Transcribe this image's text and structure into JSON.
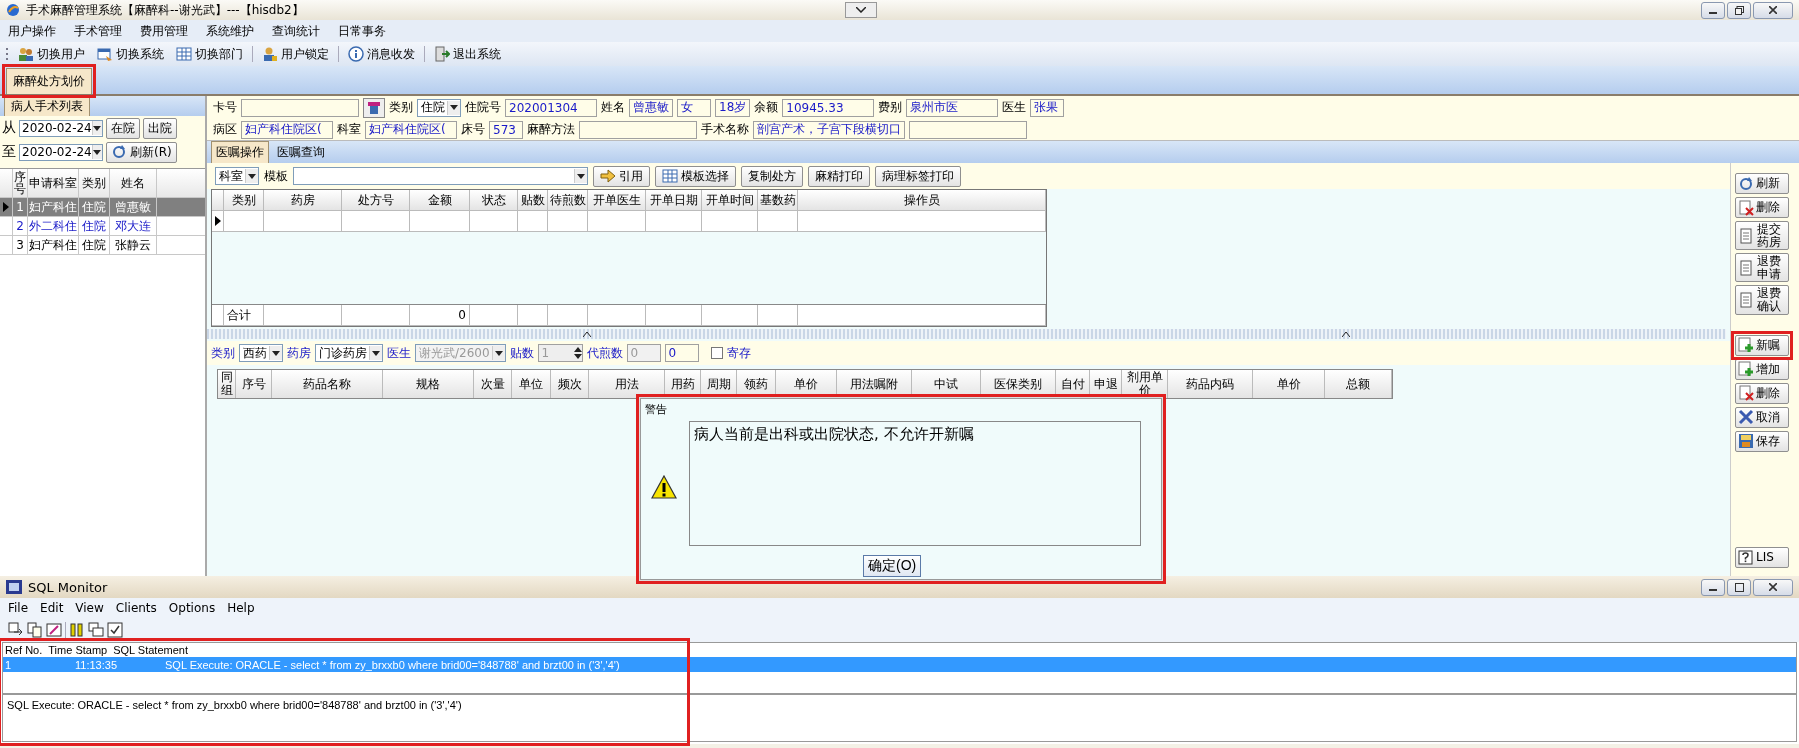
{
  "window": {
    "title": "手术麻醉管理系统【麻醉科--谢光武】---【hisdb2】"
  },
  "menu": [
    "用户操作",
    "手术管理",
    "费用管理",
    "系统维护",
    "查询统计",
    "日常事务"
  ],
  "toolbar": [
    {
      "label": "切换用户",
      "kind": "users"
    },
    {
      "label": "切换系统",
      "kind": "swap"
    },
    {
      "label": "切换部门",
      "kind": "grid"
    },
    {
      "label": "用户锁定",
      "kind": "lock"
    },
    {
      "label": "消息收发",
      "kind": "info"
    },
    {
      "label": "退出系统",
      "kind": "exit"
    }
  ],
  "module_tabs": [
    {
      "label": "麻醉处方划价",
      "selected": true
    }
  ],
  "patient_list": {
    "tab": "病人手术列表",
    "from_label": "从",
    "from_date": "2020-02-24",
    "to_label": "至",
    "to_date": "2020-02-24",
    "filters": [
      "在院",
      "出院"
    ],
    "refresh": "刷新(R)",
    "columns": [
      "序号",
      "申请科室",
      "类别",
      "姓名"
    ],
    "rows": [
      {
        "cells": [
          "1",
          "妇产科住",
          "住院",
          "曾惠敏"
        ],
        "selected": true,
        "color": "#000000"
      },
      {
        "cells": [
          "2",
          "外二科住",
          "住院",
          "邓大连"
        ],
        "selected": false,
        "color": "#1a1ac8"
      },
      {
        "cells": [
          "3",
          "妇产科住",
          "住院",
          "张静云"
        ],
        "selected": false,
        "color": "#000000"
      }
    ]
  },
  "patient_info": [
    [
      {
        "kind": "label",
        "text": "卡号"
      },
      {
        "kind": "input"
      },
      {
        "kind": "icon-button"
      },
      {
        "kind": "label",
        "text": "类别"
      },
      {
        "kind": "select",
        "value": "住院"
      },
      {
        "kind": "label",
        "text": "住院号"
      },
      {
        "kind": "input",
        "value": "202001304"
      },
      {
        "kind": "label",
        "text": "姓名"
      },
      {
        "kind": "input",
        "value": "曾惠敏"
      },
      {
        "kind": "input",
        "value": "女"
      },
      {
        "kind": "input",
        "value": "18岁"
      },
      {
        "kind": "label",
        "text": "余额"
      },
      {
        "kind": "input",
        "value": "10945.33"
      },
      {
        "kind": "label",
        "text": "费别"
      },
      {
        "kind": "input",
        "value": "泉州市医"
      },
      {
        "kind": "label",
        "text": "医生"
      },
      {
        "kind": "input",
        "value": "张果"
      }
    ],
    [
      {
        "kind": "label",
        "text": "病区"
      },
      {
        "kind": "input",
        "value": "妇产科住院区("
      },
      {
        "kind": "label",
        "text": "科室"
      },
      {
        "kind": "input",
        "value": "妇产科住院区("
      },
      {
        "kind": "label",
        "text": "床号"
      },
      {
        "kind": "input",
        "value": "573"
      },
      {
        "kind": "label",
        "text": "麻醉方法"
      },
      {
        "kind": "input"
      },
      {
        "kind": "label",
        "text": "手术名称"
      },
      {
        "kind": "input",
        "value": "剖宫产术，子宫下段横切口"
      },
      {
        "kind": "input"
      }
    ]
  ],
  "order_tabs": [
    {
      "label": "医嘱操作",
      "selected": true
    },
    {
      "label": "医嘱查询",
      "selected": false
    }
  ],
  "order_toolbar": [
    {
      "kind": "select",
      "value": "科室"
    },
    {
      "kind": "label",
      "text": "模板"
    },
    {
      "kind": "combo"
    },
    {
      "kind": "button",
      "text": "引用"
    },
    {
      "kind": "button",
      "text": "模板选择"
    },
    {
      "kind": "button",
      "text": "复制处方"
    },
    {
      "kind": "button",
      "text": "麻精打印"
    },
    {
      "kind": "button",
      "text": "病理标签打印"
    }
  ],
  "prescription_grid": {
    "columns": [
      "类别",
      "药房",
      "处方号",
      "金额",
      "状态",
      "贴数",
      "待煎数",
      "开单医生",
      "开单日期",
      "开单时间",
      "基数药",
      "操作员"
    ],
    "footer_label": "合计",
    "footer_amount": "0"
  },
  "order_form": [
    {
      "kind": "label",
      "text": "类别"
    },
    {
      "kind": "select",
      "value": "西药"
    },
    {
      "kind": "label",
      "text": "药房"
    },
    {
      "kind": "select",
      "value": "门诊药房"
    },
    {
      "kind": "label",
      "text": "医生"
    },
    {
      "kind": "select",
      "value": "谢光武/2600",
      "disabled": true
    },
    {
      "kind": "label",
      "text": "贴数"
    },
    {
      "kind": "spinner",
      "value": "1"
    },
    {
      "kind": "label",
      "text": "代煎数"
    },
    {
      "kind": "input",
      "value": "0",
      "disabled": true
    },
    {
      "kind": "input",
      "value": "0",
      "disabled": false
    },
    {
      "kind": "checkbox",
      "text": "寄存",
      "checked": false
    }
  ],
  "drug_grid": {
    "columns": [
      "同组",
      "序号",
      "药品名称",
      "规格",
      "次量",
      "单位",
      "频次",
      "用法",
      "用药",
      "周期",
      "领药",
      "单价",
      "用法嘱附",
      "中试",
      "医保类别",
      "自付",
      "申退",
      "剂用单价",
      "药品内码",
      "单价",
      "总额"
    ]
  },
  "side_buttons": {
    "top": [
      "刷新",
      "删除",
      "提交药房",
      "退费申请",
      "退费确认"
    ],
    "middle": [
      "新嘱",
      "增加",
      "删除",
      "取消",
      "保存"
    ],
    "bottom": [
      "LIS"
    ]
  },
  "dialog": {
    "title": "警告",
    "message": "病人当前是出科或出院状态, 不允许开新嘱",
    "button": "确定(O)"
  },
  "sql_monitor": {
    "title": "SQL Monitor",
    "menu": [
      "File",
      "Edit",
      "View",
      "Clients",
      "Options",
      "Help"
    ],
    "columns": [
      "Ref No.",
      "Time Stamp",
      "SQL Statement"
    ],
    "rows": [
      {
        "cells": [
          "1",
          "11:13:35",
          "SQL Execute: ORACLE - select * from zy_brxxb0 where brid00='848788' and brzt00 in ('3','4')"
        ],
        "selected": true
      }
    ],
    "detail": "SQL Execute: ORACLE - select * from zy_brxxb0 where brid00='848788' and brzt00 in ('3','4')"
  }
}
